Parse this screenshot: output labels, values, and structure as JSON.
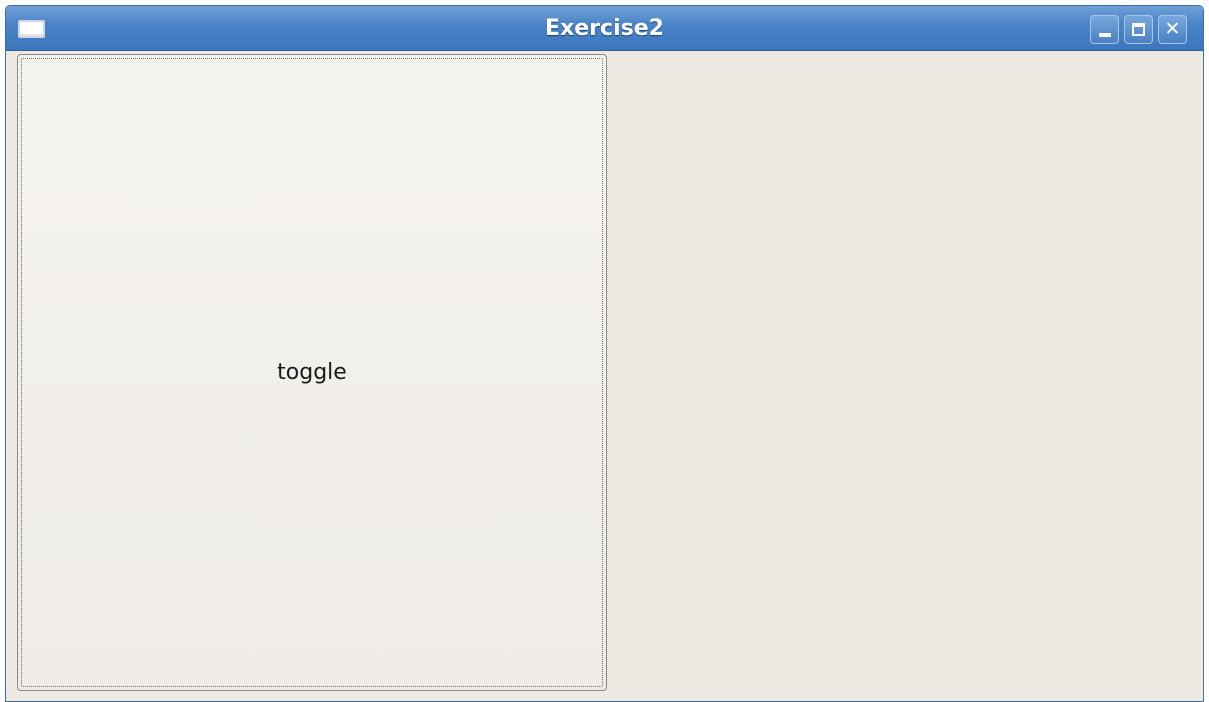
{
  "window": {
    "title": "Exercise2",
    "menu_icon": "window-menu-icon",
    "controls": {
      "minimize_icon": "minimize-icon",
      "maximize_icon": "maximize-icon",
      "close_icon": "close-icon",
      "close_glyph": "✕"
    }
  },
  "content": {
    "toggle_label": "toggle"
  },
  "colors": {
    "titlebar": "#4c86c9",
    "background": "#edeae4",
    "button_face": "#f2f0ec"
  }
}
